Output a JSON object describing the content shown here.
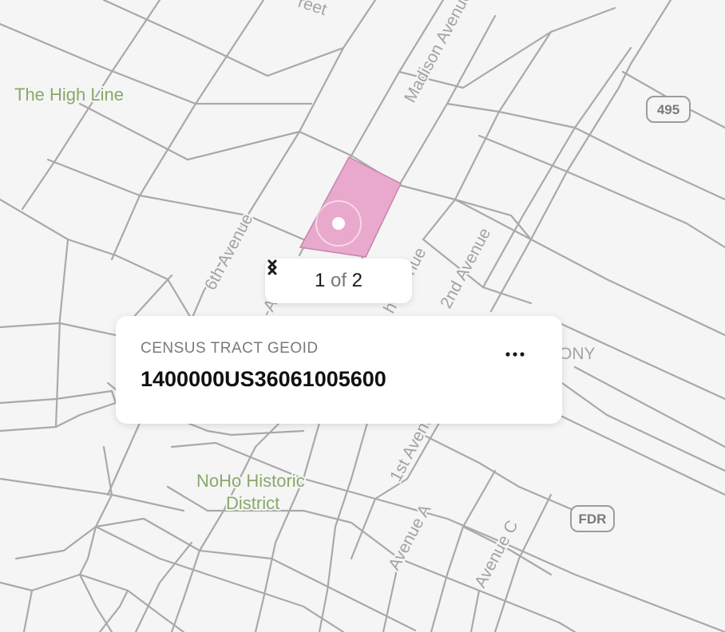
{
  "map": {
    "streets": [
      "Madison Avenue",
      "6th Avenue",
      "2nd Avenue",
      "1st Avenue",
      "Avenue A",
      "Avenue C"
    ],
    "street_fragments": [
      "reet",
      "h-Avenue",
      "-A"
    ],
    "pois": [
      "The High Line",
      "NoHo Historic",
      "District"
    ],
    "shields": [
      "495",
      "FDR"
    ],
    "partial_labels": [
      "ONY"
    ],
    "highlight_color": "#e9a9cc",
    "road_color": "#a9a9a9"
  },
  "pager": {
    "current": "1",
    "of_label": "of",
    "total": "2"
  },
  "popup": {
    "label": "CENSUS TRACT GEOID",
    "value": "1400000US36061005600"
  },
  "icons": [
    "chevron-left-icon",
    "chevron-right-icon",
    "more-horizontal-icon",
    "location-dot-icon"
  ]
}
